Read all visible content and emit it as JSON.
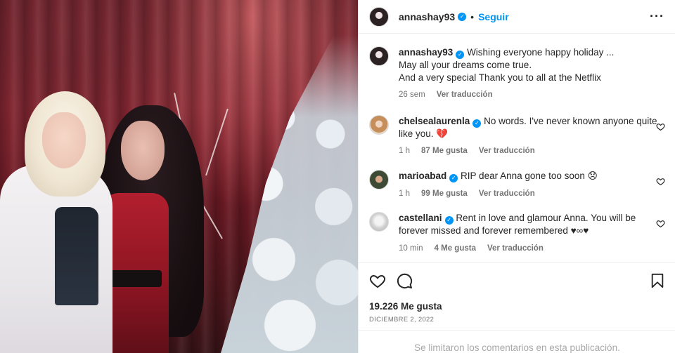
{
  "post": {
    "author": "annashay93",
    "follow_label": "Seguir",
    "dot": "•",
    "more_icon": "more-horizontal-icon"
  },
  "caption": {
    "user": "annashay93",
    "text": "Wishing everyone happy holiday ...",
    "line2": "May all your dreams come true.",
    "line3": "And a very special Thank you to all at the Netflix",
    "time": "26 sem",
    "translate": "Ver traducción"
  },
  "comments": [
    {
      "user": "chelsealaurenla",
      "text": "No words. I've never known anyone quite like you. 💔",
      "time": "1 h",
      "likes": "87 Me gusta",
      "translate": "Ver traducción"
    },
    {
      "user": "marioabad",
      "text": "RIP dear Anna gone too soon 😞",
      "time": "1 h",
      "likes": "99 Me gusta",
      "translate": "Ver traducción"
    },
    {
      "user": "castellani",
      "text": "Rent in love and glamour Anna. You will be forever missed and forever remembered ♥∞♥",
      "time": "10 min",
      "likes": "4 Me gusta",
      "translate": "Ver traducción"
    }
  ],
  "engagement": {
    "likes": "19.226 Me gusta",
    "date": "DICIEMBRE 2, 2022"
  },
  "footer": {
    "limited_comments": "Se limitaron los comentarios en esta publicación."
  },
  "colors": {
    "accent": "#0095f6",
    "text": "#262626",
    "muted": "#737373"
  }
}
